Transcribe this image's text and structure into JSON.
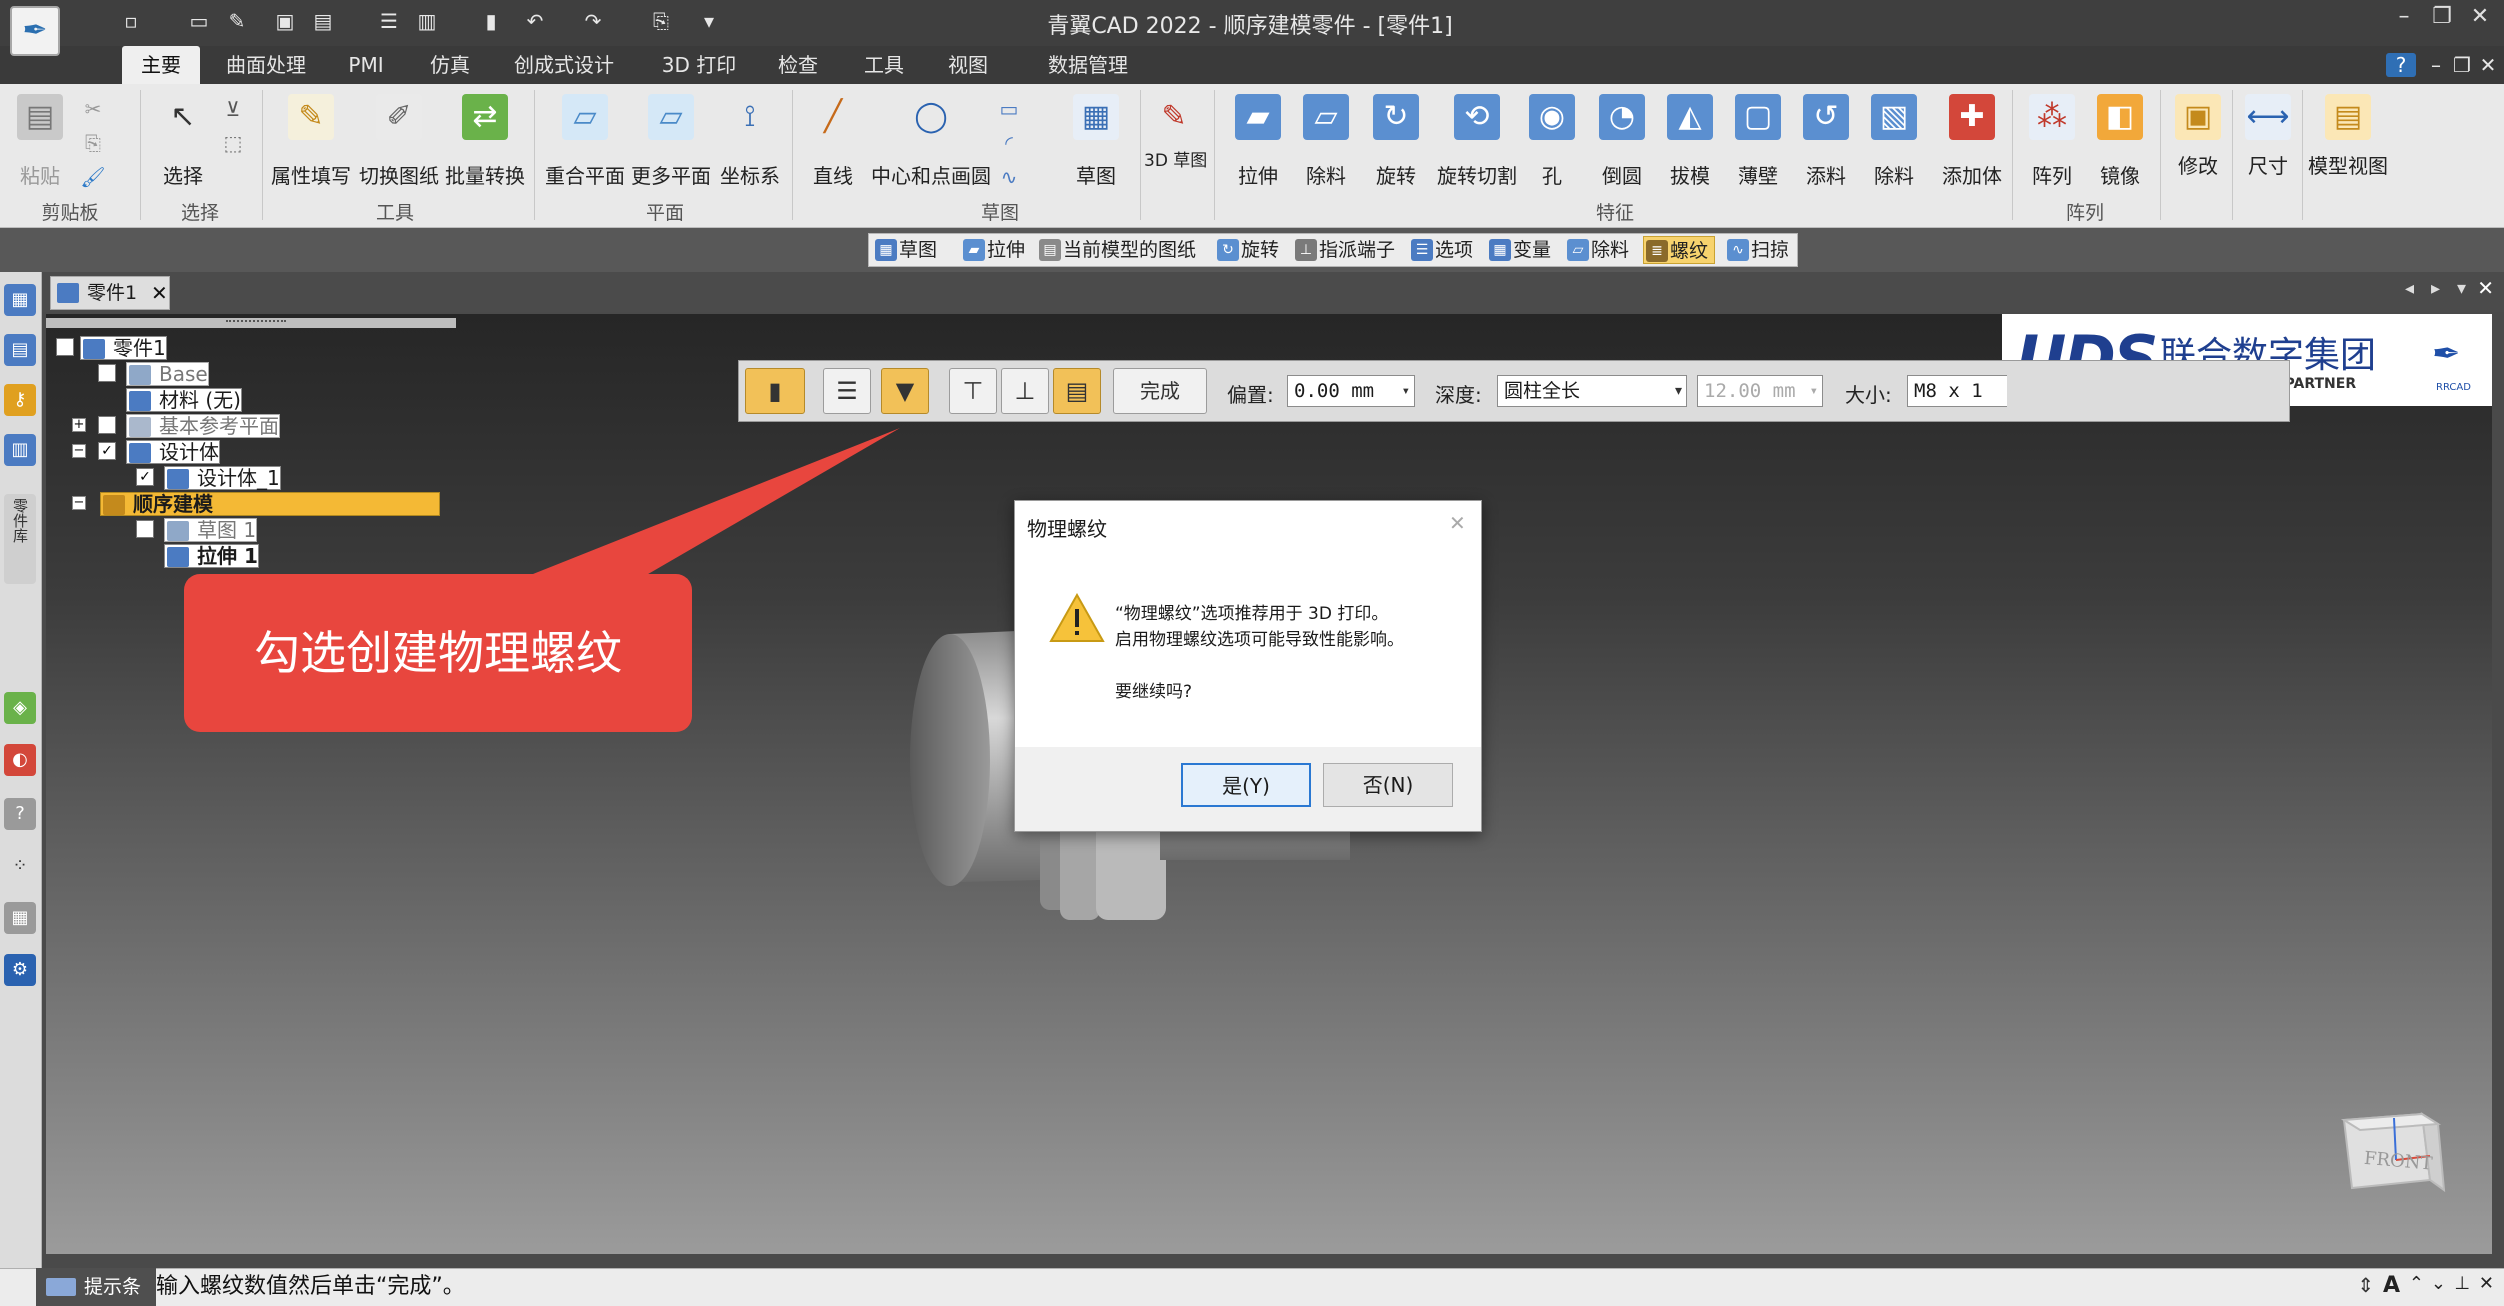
{
  "app": {
    "title": "青翼CAD 2022 - 顺序建模零件 - [零件1]"
  },
  "quick_access": [
    "new-doc-icon",
    "open-icon",
    "save-icon",
    "save-all-icon",
    "print-icon",
    "clipboard-icon",
    "undo-icon",
    "redo-icon",
    "customize-icon"
  ],
  "tabs": [
    "主要",
    "曲面处理",
    "PMI",
    "仿真",
    "创成式设计",
    "3D 打印",
    "检查",
    "工具",
    "视图",
    "数据管理"
  ],
  "ribbon": {
    "paste": "粘贴",
    "select": "选择",
    "tools": [
      "属性填写",
      "切换图纸",
      "批量转换"
    ],
    "planes": [
      "重合平面",
      "更多平面",
      "坐标系"
    ],
    "sketch_tools": [
      "直线",
      "中心和点画圆"
    ],
    "sketch": "草图",
    "sketch3d": "3D 草图",
    "features": [
      "拉伸",
      "除料",
      "旋转",
      "旋转切割",
      "孔",
      "倒圆",
      "拔模",
      "薄壁",
      "添料",
      "除料",
      "添加体"
    ],
    "pattern": [
      "阵列",
      "镜像"
    ],
    "modify": "修改",
    "dimension": "尺寸",
    "model_view": "模型视图",
    "groups": [
      "剪贴板",
      "选择",
      "工具",
      "平面",
      "草图",
      "特征",
      "阵列"
    ]
  },
  "cmdbar": [
    "草图",
    "拉伸",
    "当前模型的图纸",
    "旋转",
    "指派端子",
    "选项",
    "变量",
    "除料",
    "螺纹",
    "扫掠"
  ],
  "doc_tab": "零件1",
  "tree": {
    "root": "零件1",
    "base": "Base",
    "material": "材料 (无)",
    "ref_planes": "基本参考平面",
    "design_bodies": "设计体",
    "design_body_1": "设计体_1",
    "ordered": "顺序建模",
    "sketch1": "草图 1",
    "extrude1": "拉伸 1"
  },
  "threadbar": {
    "finish": "完成",
    "offset_label": "偏置:",
    "offset_value": "0.00 mm",
    "depth_label": "深度:",
    "depth_value": "圆柱全长",
    "length_value": "12.00 mm",
    "size_label": "大小:",
    "size_value": "M8 x 1"
  },
  "logo": {
    "brand": "UDS",
    "name": "联合数字集团",
    "tagline": "YOUR PLM PARTNER",
    "sub": "RRCAD"
  },
  "callout": "勾选创建物理螺纹",
  "dialog": {
    "title": "物理螺纹",
    "line1": "“物理螺纹”选项推荐用于 3D 打印。",
    "line2": "启用物理螺纹选项可能导致性能影响。",
    "question": "要继续吗?",
    "yes": "是(Y)",
    "no": "否(N)"
  },
  "status": {
    "label": "提示条",
    "text": "输入螺纹数值然后单击“完成”。"
  },
  "viewcube": "FRONT",
  "leftbar_label": "零件库"
}
